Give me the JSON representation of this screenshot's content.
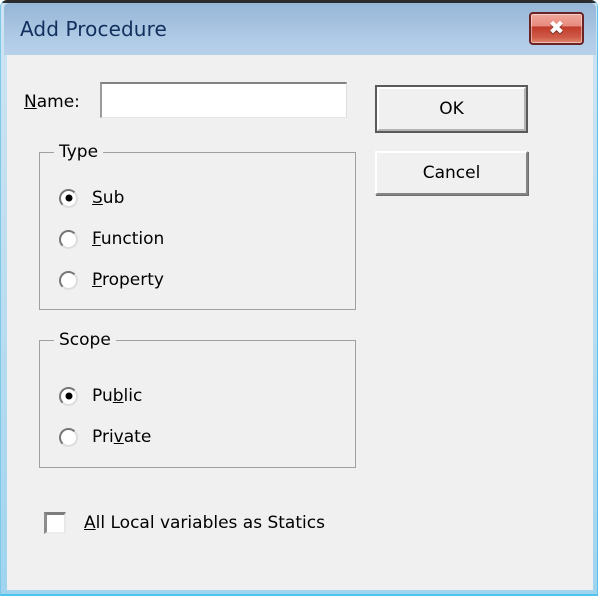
{
  "window": {
    "title": "Add Procedure",
    "close_label": "✖",
    "close_icon": "close-icon",
    "frame_color": "#a8d4ee",
    "titlebar_color_top": "#96b6d8",
    "titlebar_color_bottom": "#b8d1ea",
    "client_bg": "#f0f0f0",
    "close_button_color": "#c03b2c"
  },
  "form": {
    "name_label_prefix": "",
    "name_label_accel": "N",
    "name_label_suffix": "ame:",
    "name_value": "",
    "name_placeholder": ""
  },
  "buttons": {
    "ok": "OK",
    "cancel": "Cancel"
  },
  "type_group": {
    "legend": "Type",
    "options": [
      {
        "prefix": "",
        "accel": "S",
        "suffix": "ub",
        "checked": true
      },
      {
        "prefix": "",
        "accel": "F",
        "suffix": "unction",
        "checked": false
      },
      {
        "prefix": "",
        "accel": "P",
        "suffix": "roperty",
        "checked": false
      }
    ]
  },
  "scope_group": {
    "legend": "Scope",
    "options": [
      {
        "prefix": "Pu",
        "accel": "b",
        "suffix": "lic",
        "checked": true
      },
      {
        "prefix": "Pri",
        "accel": "v",
        "suffix": "ate",
        "checked": false
      }
    ]
  },
  "statics_checkbox": {
    "prefix": "",
    "accel": "A",
    "suffix": "ll Local variables as Statics",
    "checked": false
  }
}
